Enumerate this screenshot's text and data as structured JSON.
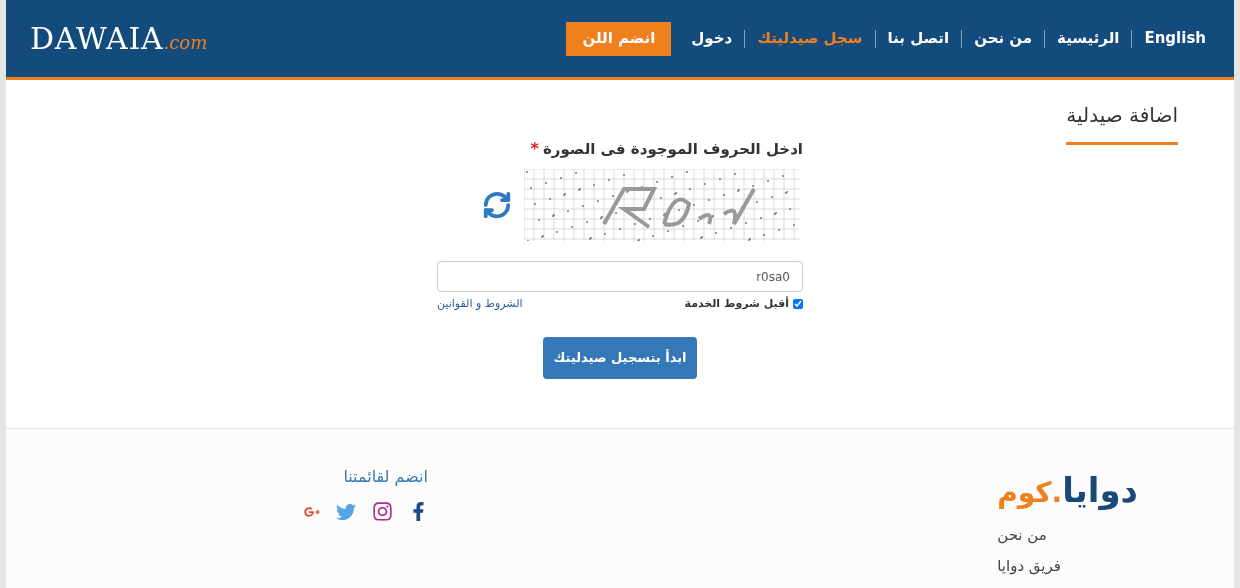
{
  "header": {
    "logo": {
      "main": "DAWAIA",
      "suffix": ".com"
    },
    "nav": [
      {
        "label": "English",
        "selected": false
      },
      {
        "label": "الرئيسية",
        "selected": false
      },
      {
        "label": "من نحن",
        "selected": false
      },
      {
        "label": "اتصل بنا",
        "selected": false
      },
      {
        "label": "سجل صيدليتك",
        "selected": true
      },
      {
        "label": "دخول",
        "selected": false
      }
    ],
    "join_button": "انضم اللن"
  },
  "section_title": "اضافة صيدلية",
  "form": {
    "captcha_label": "ادخل الحروف الموجودة فى الصورة",
    "required_mark": "*",
    "captcha_input": {
      "value": "r0sa0"
    },
    "terms": {
      "label": "أقبل شروط الخدمة",
      "checked": true
    },
    "terms_link": "الشروط و القوانين",
    "submit": "ابدأ بتسجيل صيدليتك"
  },
  "footer": {
    "logo": {
      "main": "دوايا",
      "suffix": ".كوم"
    },
    "links": [
      "من نحن",
      "فريق دوايا"
    ],
    "join_title": "انضم لقائمتنا"
  }
}
